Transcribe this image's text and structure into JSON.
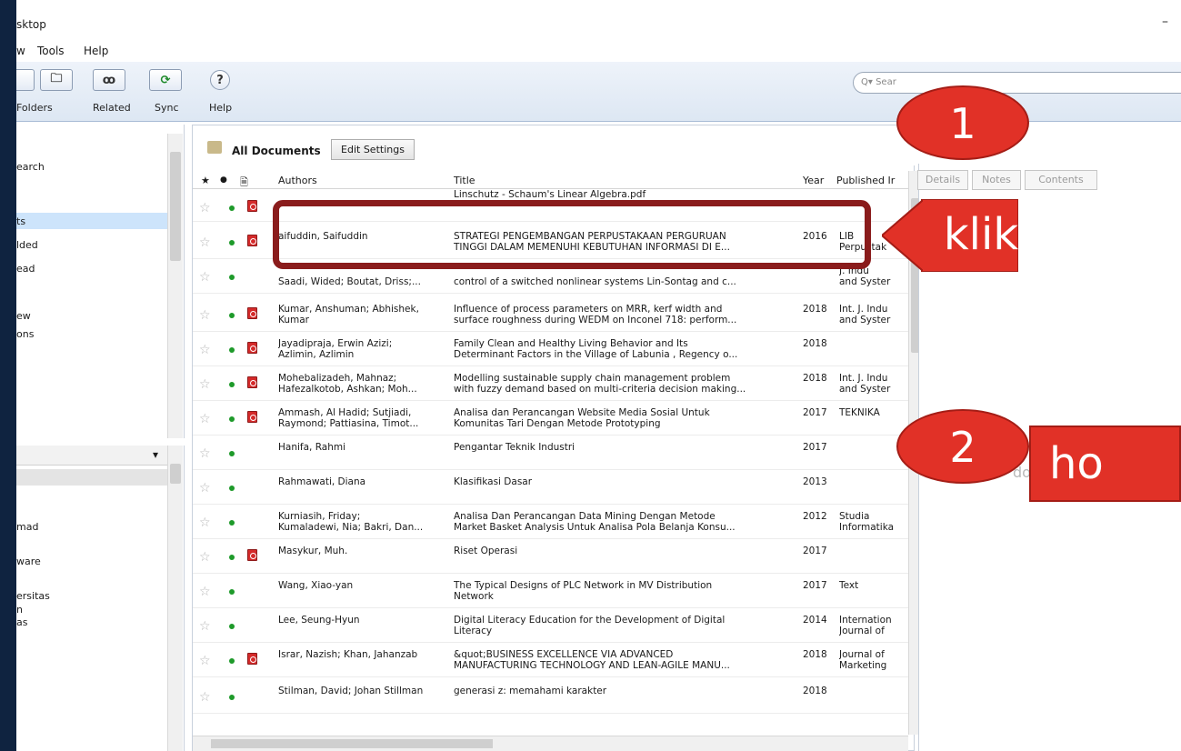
{
  "window": {
    "title": "sktop",
    "minimize_glyph": "–"
  },
  "menu": [
    "w",
    "Tools",
    "Help"
  ],
  "toolbar": {
    "buttons": [
      {
        "icon": "folder-icon",
        "glyph": "🗀",
        "label": "Folders"
      },
      {
        "icon": "related-icon",
        "glyph": "ꝏ",
        "label": "Related"
      },
      {
        "icon": "sync-icon",
        "glyph": "⟳",
        "label": "Sync"
      },
      {
        "icon": "help-icon",
        "glyph": "?",
        "label": "Help"
      }
    ],
    "search_placeholder": "Q▾ Sear"
  },
  "left_panel": {
    "items": [
      "earch",
      "ts",
      "lded",
      "ead",
      "ew",
      "ons"
    ],
    "groups": [
      "mad",
      "ware",
      "ersitas",
      "n",
      "as"
    ],
    "dropdown_glyph": "▾"
  },
  "center": {
    "folder_title": "All Documents",
    "edit_button": "Edit Settings",
    "columns": {
      "star": "★",
      "read": "●",
      "file": "🗎",
      "authors": "Authors",
      "title": "Title",
      "year": "Year",
      "published": "Published Ir"
    },
    "rows": [
      {
        "authors": "",
        "title": "Linschutz - Schaum's Linear Algebra.pdf",
        "year": "",
        "pub": "",
        "pdf": true
      },
      {
        "authors": "aifuddin, Saifuddin",
        "title": "STRATEGI PENGEMBANGAN PERPUSTAKAAN PERGURUAN\nTINGGI DALAM MEMENUHI KEBUTUHAN INFORMASI DI E...",
        "year": "2016",
        "pub": "LIB\nPerpustak",
        "pdf": true
      },
      {
        "authors": "\nSaadi, Wided; Boutat, Driss;...",
        "title": "\ncontrol of a switched nonlinear systems Lin-Sontag and c...",
        "year": "",
        "pub": "J. Indu\nand Syster",
        "pdf": false
      },
      {
        "authors": "Kumar, Anshuman; Abhishek,\nKumar",
        "title": "Influence of process parameters on MRR, kerf width and\nsurface roughness during WEDM on Inconel 718: perform...",
        "year": "2018",
        "pub": "Int. J. Indu\nand Syster",
        "pdf": true
      },
      {
        "authors": "Jayadipraja, Erwin Azizi;\nAzlimin, Azlimin",
        "title": "Family Clean and Healthy Living Behavior and Its\nDeterminant Factors in the Village of Labunia , Regency o...",
        "year": "2018",
        "pub": "",
        "pdf": true
      },
      {
        "authors": "Mohebalizadeh, Mahnaz;\nHafezalkotob, Ashkan; Moh...",
        "title": "Modelling sustainable supply chain management problem\nwith fuzzy demand based on multi-criteria decision making...",
        "year": "2018",
        "pub": "Int. J. Indu\nand Syster",
        "pdf": true
      },
      {
        "authors": "Ammash, Al Hadid; Sutjiadi,\nRaymond; Pattiasina, Timot...",
        "title": "Analisa dan Perancangan Website Media Sosial Untuk\nKomunitas Tari Dengan Metode Prototyping",
        "year": "2017",
        "pub": "TEKNIKA",
        "pdf": true
      },
      {
        "authors": "Hanifa, Rahmi",
        "title": "Pengantar Teknik Industri",
        "year": "2017",
        "pub": "",
        "pdf": false
      },
      {
        "authors": "Rahmawati, Diana",
        "title": "Klasifikasi Dasar",
        "year": "2013",
        "pub": "",
        "pdf": false
      },
      {
        "authors": "Kurniasih, Friday;\nKumaladewi, Nia; Bakri, Dan...",
        "title": "Analisa Dan Perancangan Data Mining Dengan Metode\nMarket Basket Analysis Untuk Analisa Pola Belanja Konsu...",
        "year": "2012",
        "pub": "Studia\nInformatika",
        "pdf": false
      },
      {
        "authors": "Masykur, Muh.",
        "title": "Riset Operasi",
        "year": "2017",
        "pub": "",
        "pdf": true
      },
      {
        "authors": "Wang, Xiao-yan",
        "title": "The Typical Designs of PLC Network in MV Distribution\nNetwork",
        "year": "2017",
        "pub": "Text",
        "pdf": false
      },
      {
        "authors": "Lee, Seung-Hyun",
        "title": "Digital Literacy Education for the Development of Digital\nLiteracy",
        "year": "2014",
        "pub": "Internation\nJournal of",
        "pdf": false
      },
      {
        "authors": "Israr, Nazish; Khan, Jahanzab",
        "title": "&quot;BUSINESS EXCELLENCE VIA ADVANCED\nMANUFACTURING TECHNOLOGY AND LEAN-AGILE MANU...",
        "year": "2018",
        "pub": "Journal of\nMarketing",
        "pdf": true
      },
      {
        "authors": "Stilman, David; Johan Stillman",
        "title": "generasi z: memahami karakter",
        "year": "2018",
        "pub": "",
        "pdf": false
      }
    ]
  },
  "right_panel": {
    "tabs": [
      "Details",
      "Notes",
      "Contents"
    ],
    "fragment": "do"
  },
  "annotations": {
    "step1": "1",
    "step2": "2",
    "klik": "klik",
    "ho": "ho",
    "color_red": "#e13127",
    "color_dark_red": "#8a1c1c"
  }
}
